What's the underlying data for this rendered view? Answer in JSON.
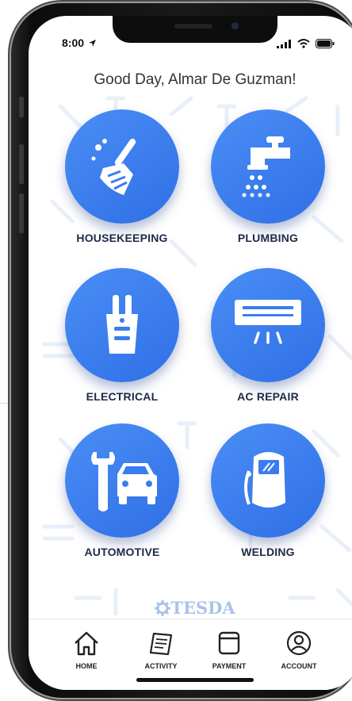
{
  "status": {
    "time": "8:00",
    "location_icon": "location-arrow-icon",
    "signal_icon": "signal-icon",
    "wifi_icon": "wifi-icon",
    "battery_icon": "battery-icon"
  },
  "header": {
    "greeting": "Good Day, Almar De Guzman!"
  },
  "services": [
    {
      "label": "HOUSEKEEPING",
      "icon": "broom-icon"
    },
    {
      "label": "PLUMBING",
      "icon": "faucet-icon"
    },
    {
      "label": "ELECTRICAL",
      "icon": "plug-icon"
    },
    {
      "label": "AC REPAIR",
      "icon": "air-conditioner-icon"
    },
    {
      "label": "AUTOMOTIVE",
      "icon": "car-wrench-icon"
    },
    {
      "label": "WELDING",
      "icon": "welding-mask-icon"
    }
  ],
  "brand": {
    "name": "TESDA"
  },
  "tabs": [
    {
      "label": "HOME",
      "icon": "home-icon"
    },
    {
      "label": "ACTIVITY",
      "icon": "activity-icon"
    },
    {
      "label": "PAYMENT",
      "icon": "wallet-icon"
    },
    {
      "label": "ACCOUNT",
      "icon": "account-icon"
    }
  ],
  "colors": {
    "accent": "#3b7df0",
    "text": "#1d2a44",
    "brand": "#a9c3ec"
  }
}
